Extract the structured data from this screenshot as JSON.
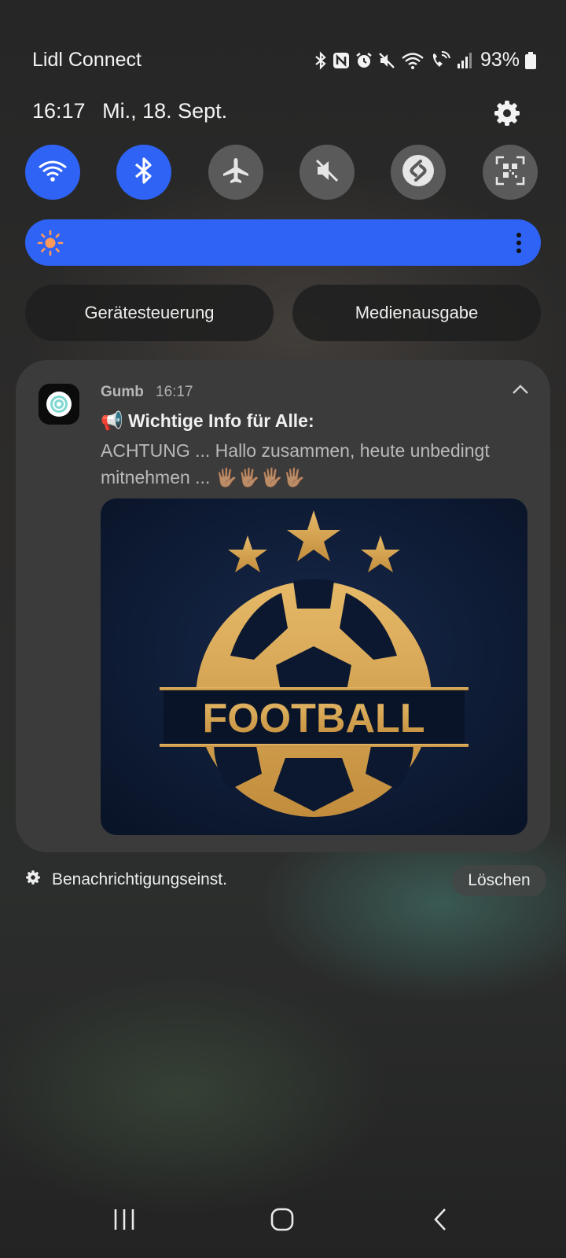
{
  "status_bar": {
    "carrier": "Lidl Connect",
    "battery": "93%",
    "icons": [
      "bluetooth-icon",
      "nfc-icon",
      "alarm-icon",
      "mute-icon",
      "wifi-icon",
      "wifi-calling-icon",
      "signal-icon",
      "battery-icon"
    ]
  },
  "header": {
    "time": "16:17",
    "date": "Mi., 18. Sept."
  },
  "quick_toggles": [
    {
      "name": "wifi",
      "icon": "wifi-icon",
      "active": true
    },
    {
      "name": "bluetooth",
      "icon": "bluetooth-icon",
      "active": true
    },
    {
      "name": "airplane-mode",
      "icon": "airplane-icon",
      "active": false
    },
    {
      "name": "sound",
      "icon": "mute-icon",
      "active": false
    },
    {
      "name": "shazam",
      "icon": "shazam-icon",
      "active": false
    },
    {
      "name": "qr-scanner",
      "icon": "qr-scanner-icon",
      "active": false
    }
  ],
  "brightness": {
    "icon": "sun-icon",
    "level": 1.0
  },
  "pills": {
    "device_control": "Gerätesteuerung",
    "media_output": "Medienausgabe"
  },
  "notification": {
    "app_name": "Gumb",
    "time": "16:17",
    "title_emoji": "📢",
    "title": "Wichtige Info für Alle:",
    "body": "ACHTUNG ... Hallo zusammen, heute unbedingt mitnehmen ... 🖐🏽🖐🏽🖐🏽🖐🏽",
    "image_text": "FOOTBALL"
  },
  "footer": {
    "notification_settings": "Benachrichtigungseinst.",
    "clear": "Löschen"
  },
  "colors": {
    "accent": "#2f63f5",
    "inactive_toggle": "#5a5a5a",
    "card": "#3b3b3b",
    "gold": "#d4a04a",
    "navy": "#0e1b33"
  }
}
